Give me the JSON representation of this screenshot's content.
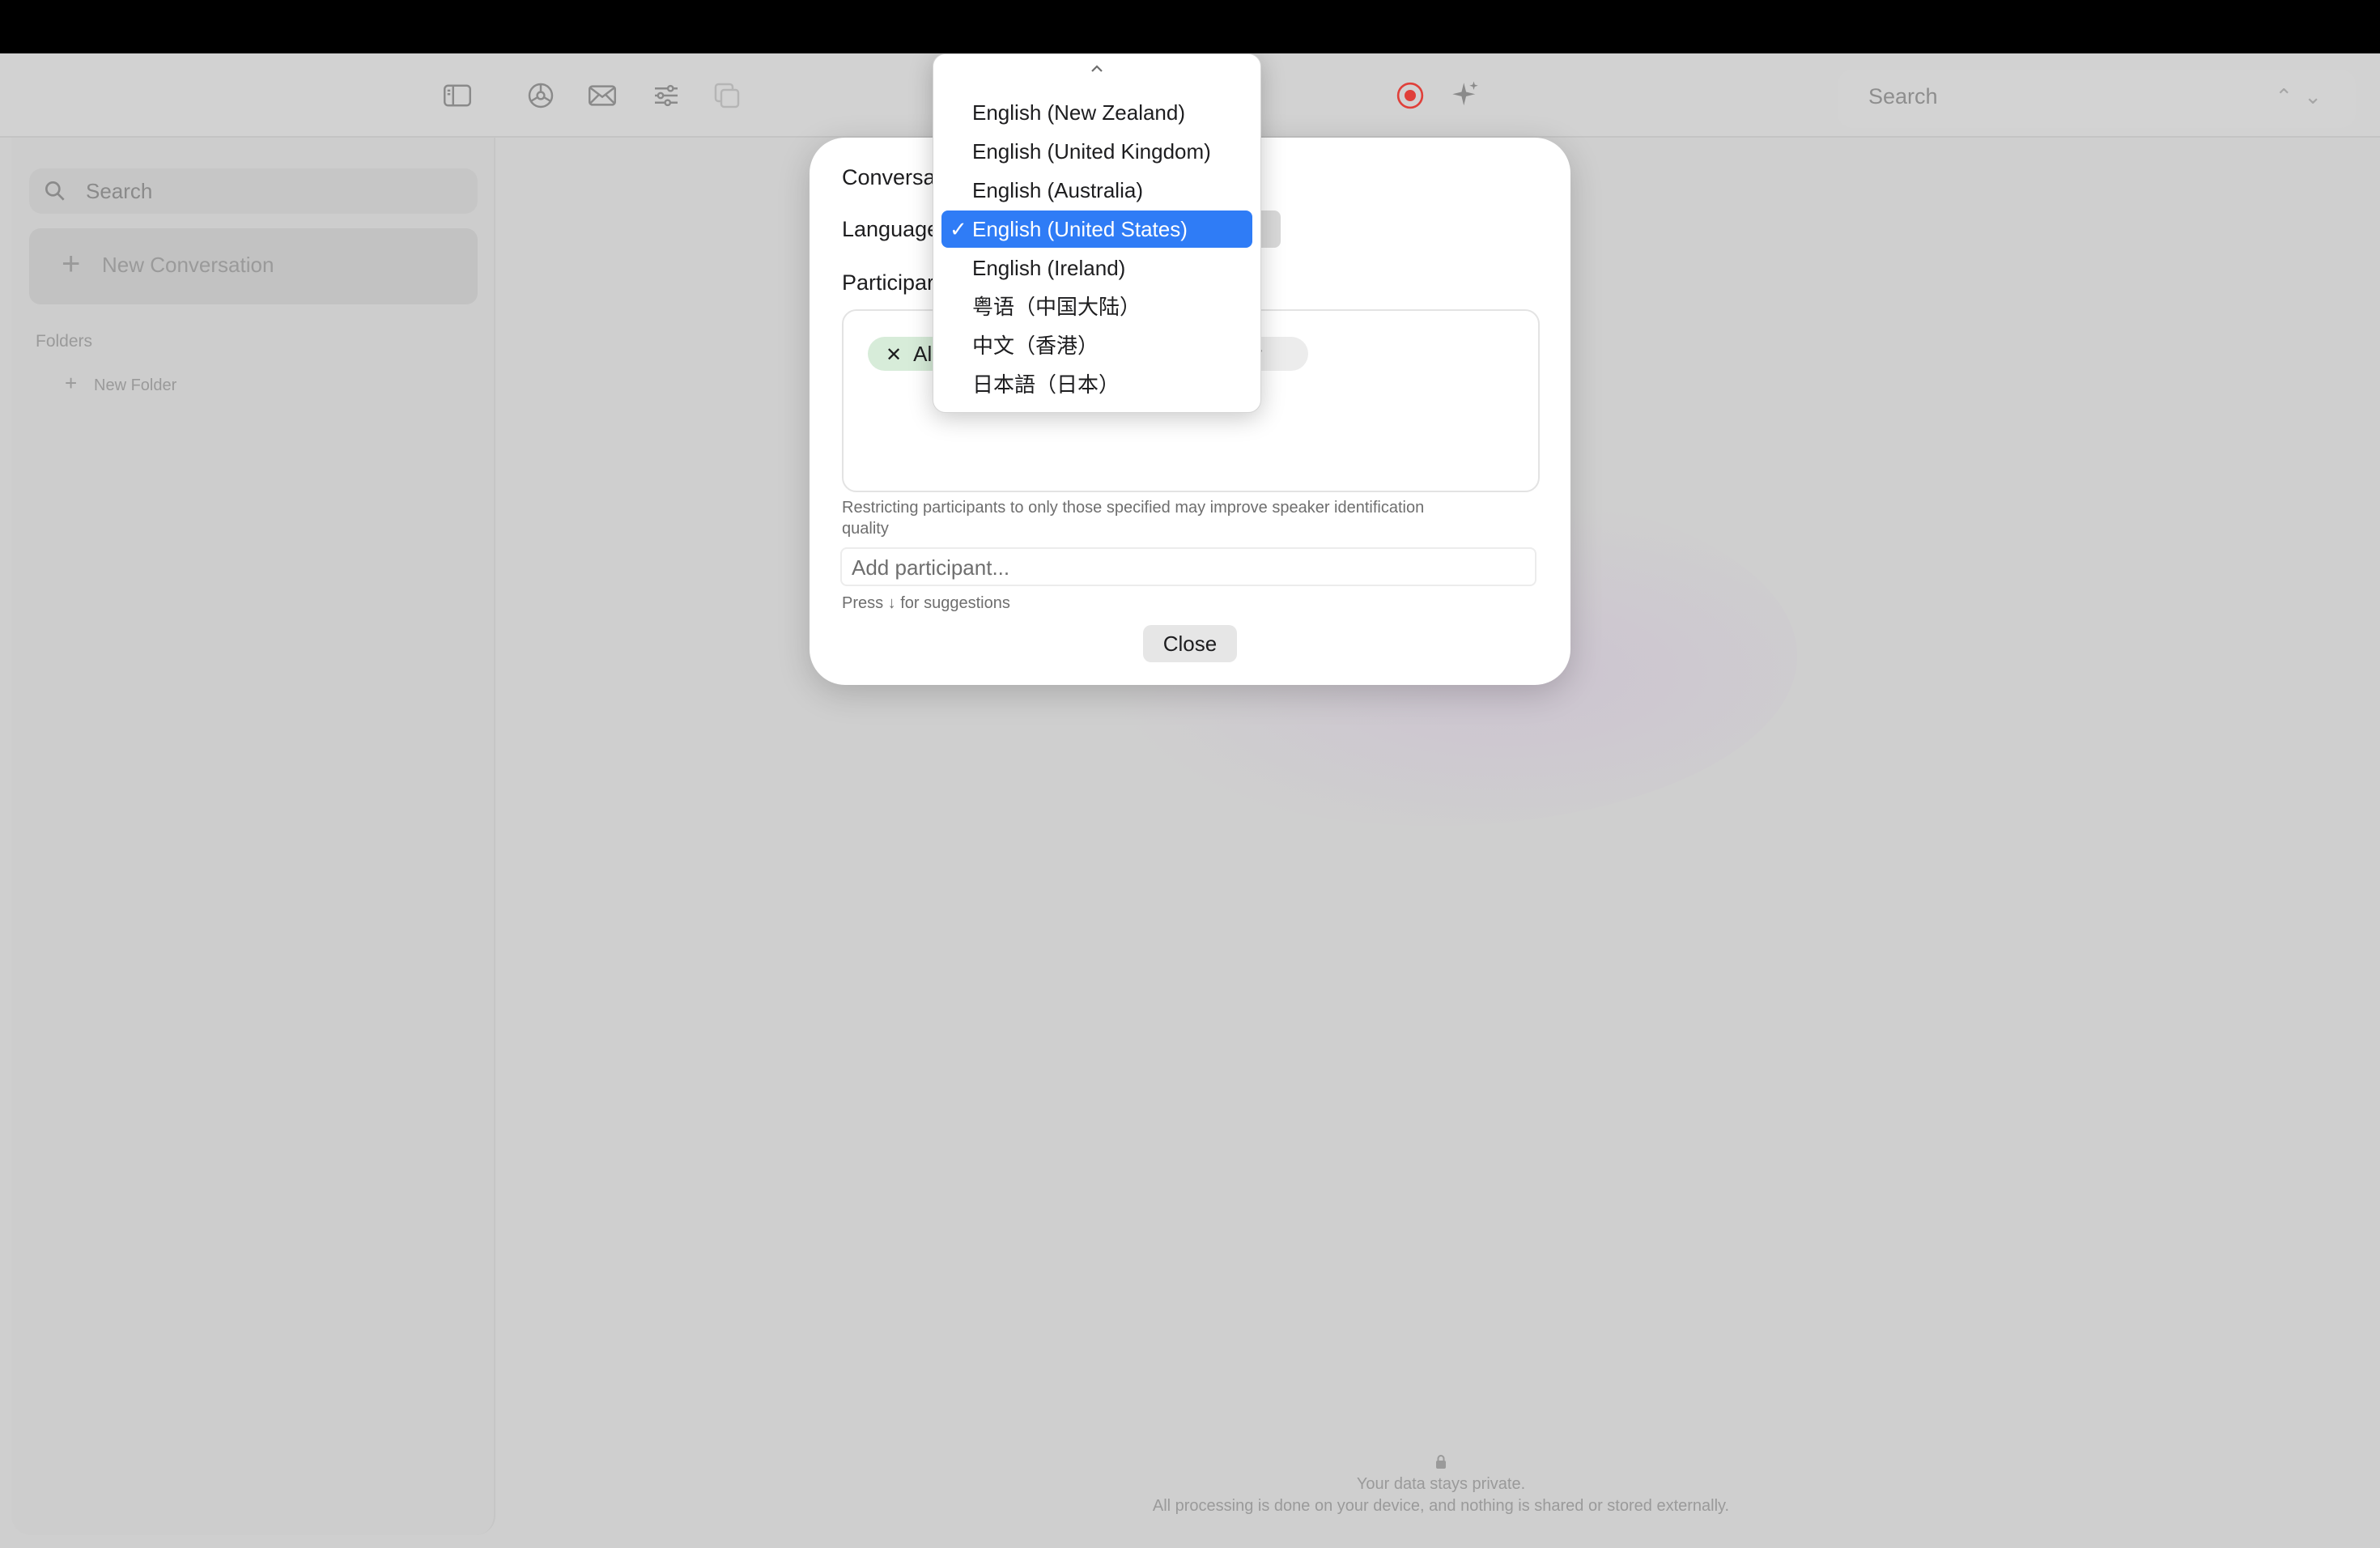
{
  "toolbar": {
    "icons": [
      "sidebar-toggle-icon",
      "gear-icon",
      "mail-icon",
      "sliders-icon",
      "copy-icon",
      "record-icon",
      "sparkle-icon"
    ],
    "search_placeholder": "Search",
    "record_color": "#e0403a"
  },
  "sidebar": {
    "search_placeholder": "Search",
    "new_conversation_label": "New Conversation",
    "folders_heading": "Folders",
    "new_folder_label": "New Folder"
  },
  "dialog": {
    "conversation_label": "Conversa",
    "language_label": "Language",
    "participants_label": "Participar",
    "chips": [
      {
        "text": "Al",
        "removable": true
      },
      {
        "text": "er",
        "removable": false
      }
    ],
    "hint": "Restricting participants to only those specified may improve speaker identification quality",
    "add_participant_placeholder": "Add participant...",
    "press_hint": "Press ↓ for suggestions",
    "close_label": "Close",
    "popup_partial_text": "s"
  },
  "language_menu": {
    "items": [
      {
        "label": "English (New Zealand)",
        "selected": false
      },
      {
        "label": "English (United Kingdom)",
        "selected": false
      },
      {
        "label": "English (Australia)",
        "selected": false
      },
      {
        "label": "English (United States)",
        "selected": true
      },
      {
        "label": "English (Ireland)",
        "selected": false
      },
      {
        "label": "粤语（中国大陆）",
        "selected": false
      },
      {
        "label": "中文（香港）",
        "selected": false
      },
      {
        "label": "日本語（日本）",
        "selected": false
      }
    ],
    "checkmark": "✓",
    "selected_color": "#2f7cf6"
  },
  "footer": {
    "line1": "Your data stays private.",
    "line2": "All processing is done on your device, and nothing is shared or stored externally."
  }
}
